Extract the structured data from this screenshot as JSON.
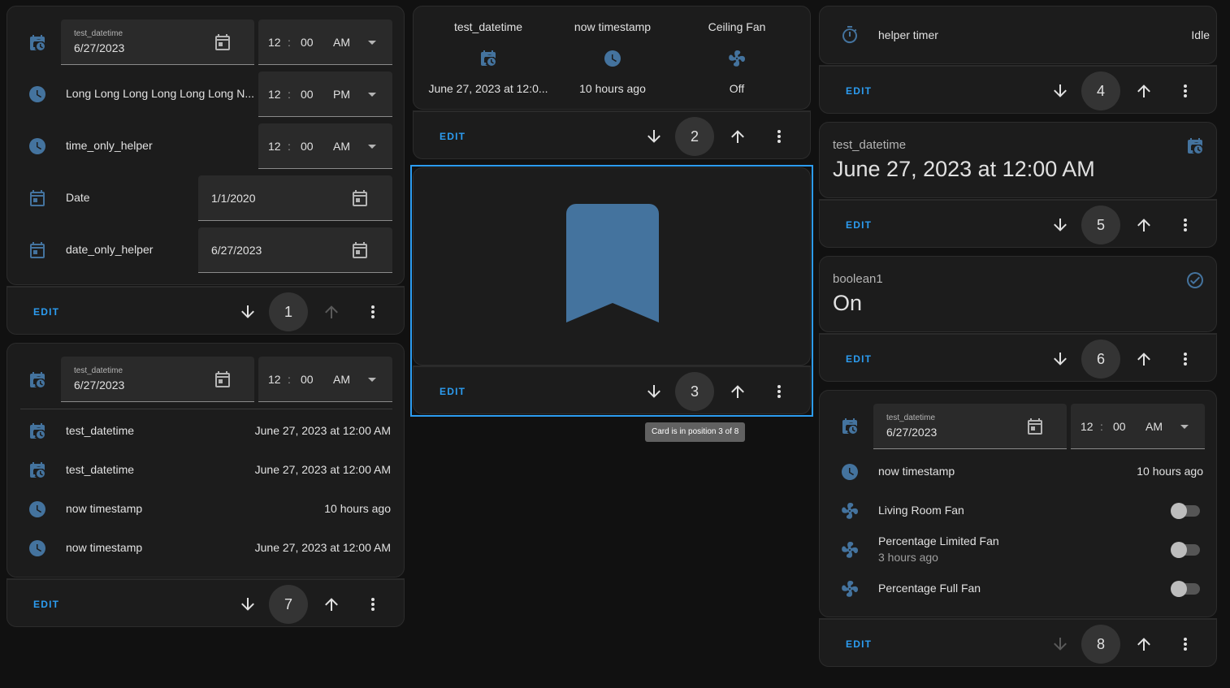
{
  "colors": {
    "accent": "#2c9cf0",
    "icon": "#44739e",
    "card": "#1c1c1c",
    "background": "#111111"
  },
  "common": {
    "edit_label": "EDIT"
  },
  "card1": {
    "datetime_label": "test_datetime",
    "datetime_date": "6/27/2023",
    "datetime_hour": "12",
    "datetime_min": "00",
    "datetime_ampm": "AM",
    "row2_name": "Long Long Long Long Long Long N...",
    "row2_hour": "12",
    "row2_min": "00",
    "row2_ampm": "PM",
    "row3_name": "time_only_helper",
    "row3_hour": "12",
    "row3_min": "00",
    "row3_ampm": "AM",
    "row4_name": "Date",
    "row4_date": "1/1/2020",
    "row5_name": "date_only_helper",
    "row5_date": "6/27/2023",
    "position": "1"
  },
  "card2": {
    "cols": [
      {
        "name": "test_datetime",
        "value": "June 27, 2023 at 12:0..."
      },
      {
        "name": "now timestamp",
        "value": "10 hours ago"
      },
      {
        "name": "Ceiling Fan",
        "value": "Off"
      }
    ],
    "position": "2"
  },
  "card3": {
    "position": "3",
    "tooltip": "Card is in position 3 of 8"
  },
  "card4": {
    "name": "helper timer",
    "state": "Idle",
    "position": "4"
  },
  "card5": {
    "name": "test_datetime",
    "state": "June 27, 2023 at 12:00 AM",
    "position": "5"
  },
  "card6": {
    "name": "boolean1",
    "state": "On",
    "position": "6"
  },
  "card7": {
    "datetime_label": "test_datetime",
    "datetime_date": "6/27/2023",
    "hour": "12",
    "min": "00",
    "ampm": "AM",
    "rows": [
      {
        "name": "test_datetime",
        "value": "June 27, 2023 at 12:00 AM"
      },
      {
        "name": "test_datetime",
        "value": "June 27, 2023 at 12:00 AM"
      },
      {
        "name": "now timestamp",
        "value": "10 hours ago"
      },
      {
        "name": "now timestamp",
        "value": "June 27, 2023 at 12:00 AM"
      }
    ],
    "position": "7"
  },
  "card8": {
    "datetime_label": "test_datetime",
    "datetime_date": "6/27/2023",
    "hour": "12",
    "min": "00",
    "ampm": "AM",
    "ts_name": "now timestamp",
    "ts_value": "10 hours ago",
    "fans": [
      {
        "name": "Living Room Fan",
        "secondary": ""
      },
      {
        "name": "Percentage Limited Fan",
        "secondary": "3 hours ago"
      },
      {
        "name": "Percentage Full Fan",
        "secondary": ""
      }
    ],
    "position": "8"
  }
}
